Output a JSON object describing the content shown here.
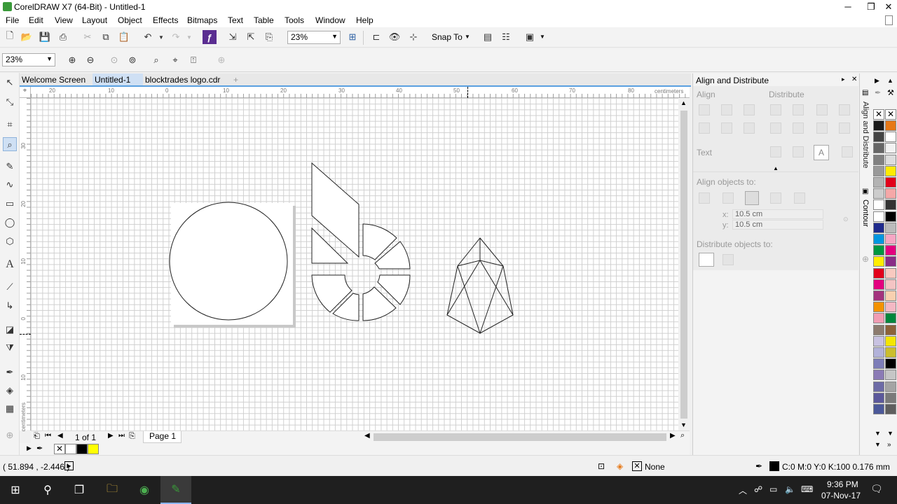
{
  "window": {
    "title": "CorelDRAW X7 (64-Bit) - Untitled-1",
    "min": "─",
    "max": "❐",
    "close": "✕"
  },
  "menu": {
    "file": "File",
    "edit": "Edit",
    "view": "View",
    "layout": "Layout",
    "object": "Object",
    "effects": "Effects",
    "bitmaps": "Bitmaps",
    "text": "Text",
    "table": "Table",
    "tools": "Tools",
    "window": "Window",
    "help": "Help"
  },
  "toolbar": {
    "zoom_value": "23%",
    "snap_to": "Snap To"
  },
  "propertybar": {
    "zoom_value": "23%"
  },
  "tabs": {
    "welcome": "Welcome Screen",
    "untitled": "Untitled-1",
    "blocktrades": "blocktrades logo.cdr",
    "add": "+"
  },
  "ruler": {
    "units": "centimeters",
    "h_labels": [
      "20",
      "10",
      "0",
      "10",
      "20",
      "30",
      "40",
      "50",
      "60",
      "70",
      "80"
    ],
    "v_labels": [
      "30",
      "20",
      "10",
      "0",
      "10"
    ],
    "v_units": "centimeters"
  },
  "pagenav": {
    "counter": "1 of 1",
    "page_tab": "Page 1"
  },
  "status": {
    "coords": "( 51.894 , -2.446 )",
    "fill": "None",
    "outline": "C:0 M:0 Y:0 K:100  0.176 mm"
  },
  "docker": {
    "title": "Align and Distribute",
    "align": "Align",
    "distribute": "Distribute",
    "text": "Text",
    "align_objects_to": "Align objects to:",
    "x_label": "x:",
    "x_value": "10.5 cm",
    "y_label": "y:",
    "y_value": "10.5 cm",
    "distribute_objects_to": "Distribute objects to:"
  },
  "docker_tabs": {
    "align": "Align and Distribute",
    "contour": "Contour"
  },
  "palette_colors": [
    "#1a1a1a",
    "#e67817",
    "#444444",
    "#ffffff",
    "#666666",
    "#f2f2f2",
    "#808080",
    "#dddddd",
    "#999999",
    "#ffeb00",
    "#b3b3b3",
    "#e2001a",
    "#cccccc",
    "#f5a8a8",
    "#ffffff",
    "#333333",
    "#ffffff",
    "#000000",
    "#1e2a8c",
    "#bbbbbb",
    "#0096e0",
    "#f6a6c4",
    "#009640",
    "#e3007f",
    "#ffed00",
    "#8a2c87",
    "#e2001a",
    "#f9c9c0",
    "#e3007f",
    "#f4c4c4",
    "#a3327d",
    "#f8d0b0",
    "#f39200",
    "#f4b8c4",
    "#f19cb3",
    "#00873c",
    "#8c7b6e",
    "#8c6239",
    "#c8c2e1",
    "#f4e600",
    "#b2b2d9",
    "#cbbe2e",
    "#7d7db8",
    "#000000",
    "#8b7bb5",
    "#c6c6c6",
    "#6d6ba6",
    "#a4a4a4",
    "#5b589b",
    "#7a7a7a",
    "#4b5899",
    "#5e5e5e"
  ],
  "doc_palette": [
    "#ffffff",
    "#000000",
    "#ffff00"
  ],
  "taskbar": {
    "time": "9:36 PM",
    "date": "07-Nov-17"
  },
  "colors": {
    "accent_corel": "#3a9a3a",
    "tab_active": "#cfe0f4",
    "page_shadow": "#c8c8c8"
  }
}
